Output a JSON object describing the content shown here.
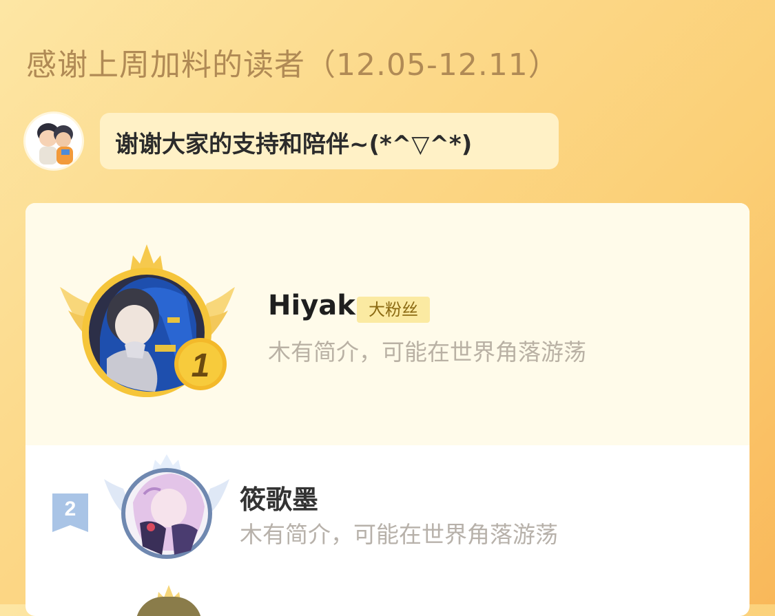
{
  "header": {
    "title": "感谢上周加料的读者（12.05-12.11）"
  },
  "message": {
    "text": "谢谢大家的支持和陪伴~(*^▽^*)"
  },
  "ranking": [
    {
      "rank": "1",
      "name": "Hiyak",
      "badge": "大粉丝",
      "bio": "木有简介，可能在世界角落游荡"
    },
    {
      "rank": "2",
      "name": "筱歌墨",
      "bio": "木有简介，可能在世界角落游荡"
    }
  ],
  "colors": {
    "background": "#fbcf76",
    "gold": "#f5c53a",
    "silver_blue": "#a9c4e6",
    "badge_bg": "#fbeaa2"
  }
}
